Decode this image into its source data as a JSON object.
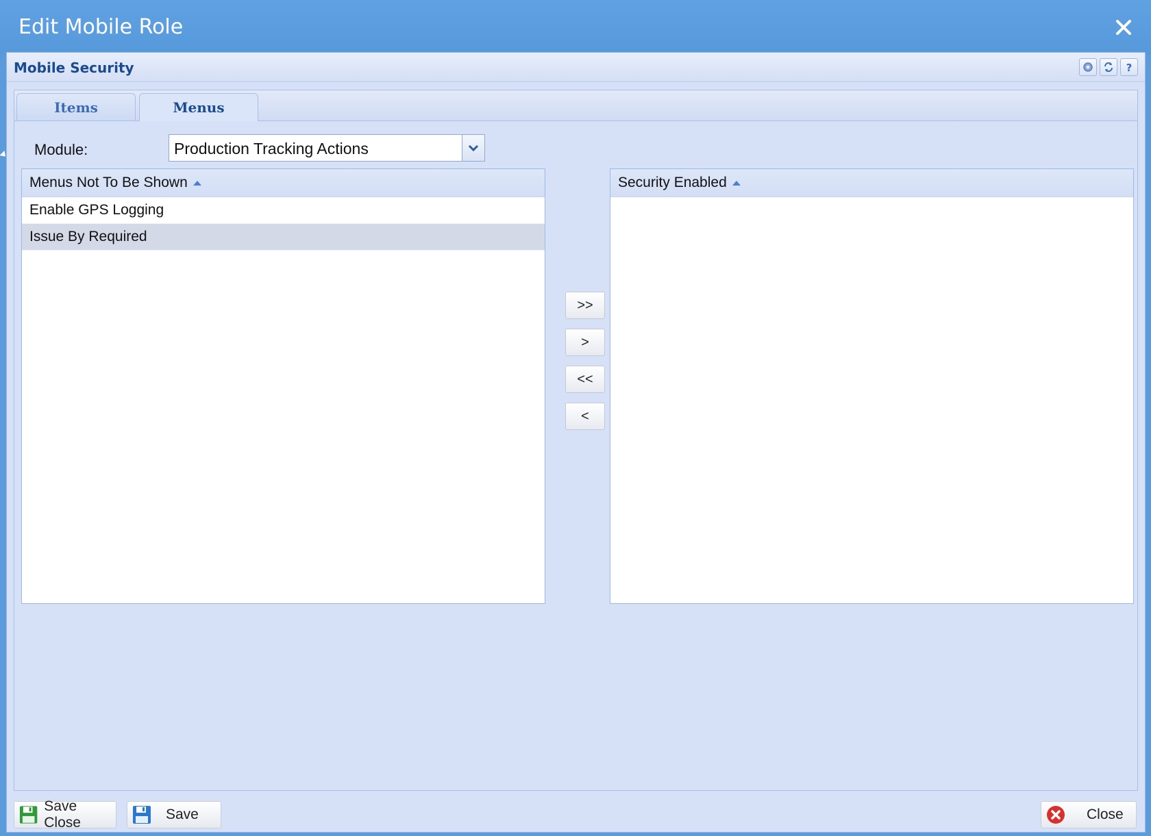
{
  "window": {
    "title": "Edit Mobile Role"
  },
  "panel": {
    "title": "Mobile Security"
  },
  "tabs": [
    {
      "label": "Items",
      "active": false
    },
    {
      "label": "Menus",
      "active": true
    }
  ],
  "module": {
    "label": "Module:",
    "value": "Production Tracking Actions"
  },
  "left_grid": {
    "header": "Menus Not To Be Shown",
    "rows": [
      "Enable GPS Logging",
      "Issue By Required"
    ],
    "selected_row": 1
  },
  "right_grid": {
    "header": "Security Enabled",
    "rows": []
  },
  "move_buttons": {
    "move_all_right": ">>",
    "move_right": ">",
    "move_all_left": "<<",
    "move_left": "<"
  },
  "footer": {
    "save_close": "Save Close",
    "save": "Save",
    "close": "Close"
  },
  "colors": {
    "titlebar": "#5b9bdc",
    "panel_bg": "#d6e0f7",
    "accent_text": "#1b4b8f"
  }
}
